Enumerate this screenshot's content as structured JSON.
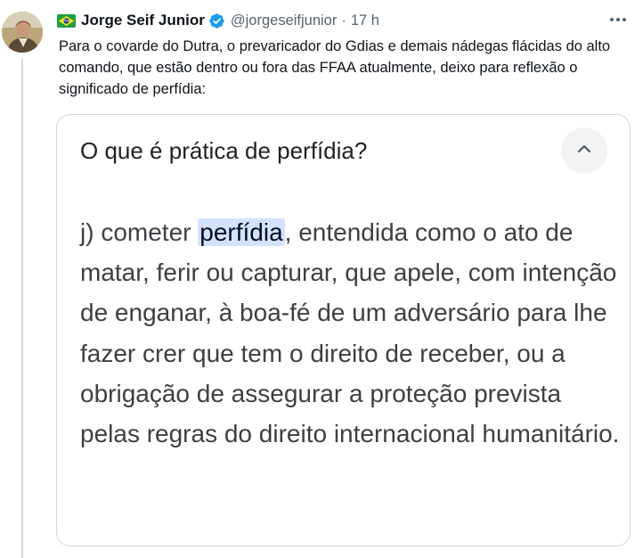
{
  "tweet": {
    "author_name": "Jorge Seif Junior",
    "handle": "@jorgeseifjunior",
    "separator": "·",
    "timestamp": "17 h",
    "flag_icon": "brazil-flag-icon",
    "verified_icon": "verified-badge-icon",
    "more_icon": "more-options-icon",
    "text": "Para o covarde do Dutra, o prevaricador do Gdias e demais nádegas flácidas do alto comando, que estão dentro ou fora das FFAA atualmente, deixo para reflexão o significado de perfídia:"
  },
  "card": {
    "question": "O que é prática de perfídia?",
    "collapse_icon": "chevron-up-icon",
    "definition_prefix": "j) cometer ",
    "definition_highlight": "perfídia",
    "definition_suffix": ", entendida como o ato de matar, ferir ou capturar, que apele, com intenção de enganar, à boa-fé de um adversário para lhe fazer crer que tem o direito de receber, ou a obrigação de assegurar a proteção prevista pelas regras do direito internacional humanitário."
  },
  "colors": {
    "link_blue": "#1d9bf0",
    "secondary_text": "#536471",
    "highlight_bg": "#d3e3fd"
  }
}
